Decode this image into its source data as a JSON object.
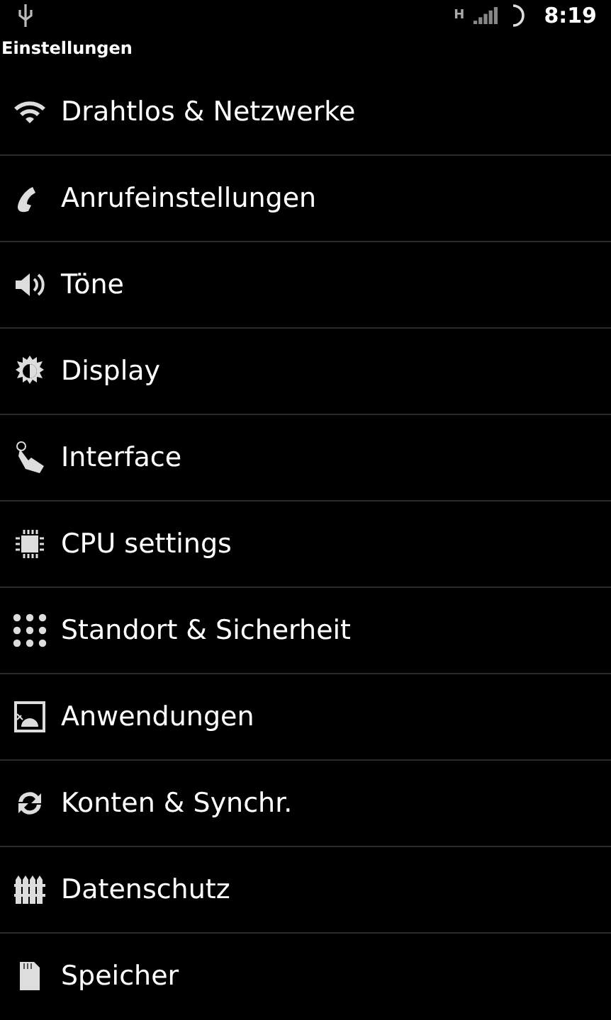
{
  "status_bar": {
    "network_type": "H",
    "time": "8:19"
  },
  "title": "Einstellungen",
  "items": [
    {
      "kind": "wifi",
      "label": "Drahtlos & Netzwerke"
    },
    {
      "kind": "phone",
      "label": "Anrufeinstellungen"
    },
    {
      "kind": "sound",
      "label": "Töne"
    },
    {
      "kind": "display",
      "label": "Display"
    },
    {
      "kind": "touch",
      "label": "Interface"
    },
    {
      "kind": "cpu",
      "label": "CPU settings"
    },
    {
      "kind": "grid",
      "label": "Standort & Sicherheit"
    },
    {
      "kind": "apps",
      "label": "Anwendungen"
    },
    {
      "kind": "sync",
      "label": "Konten & Synchr."
    },
    {
      "kind": "fence",
      "label": "Datenschutz"
    },
    {
      "kind": "sd",
      "label": "Speicher"
    }
  ]
}
